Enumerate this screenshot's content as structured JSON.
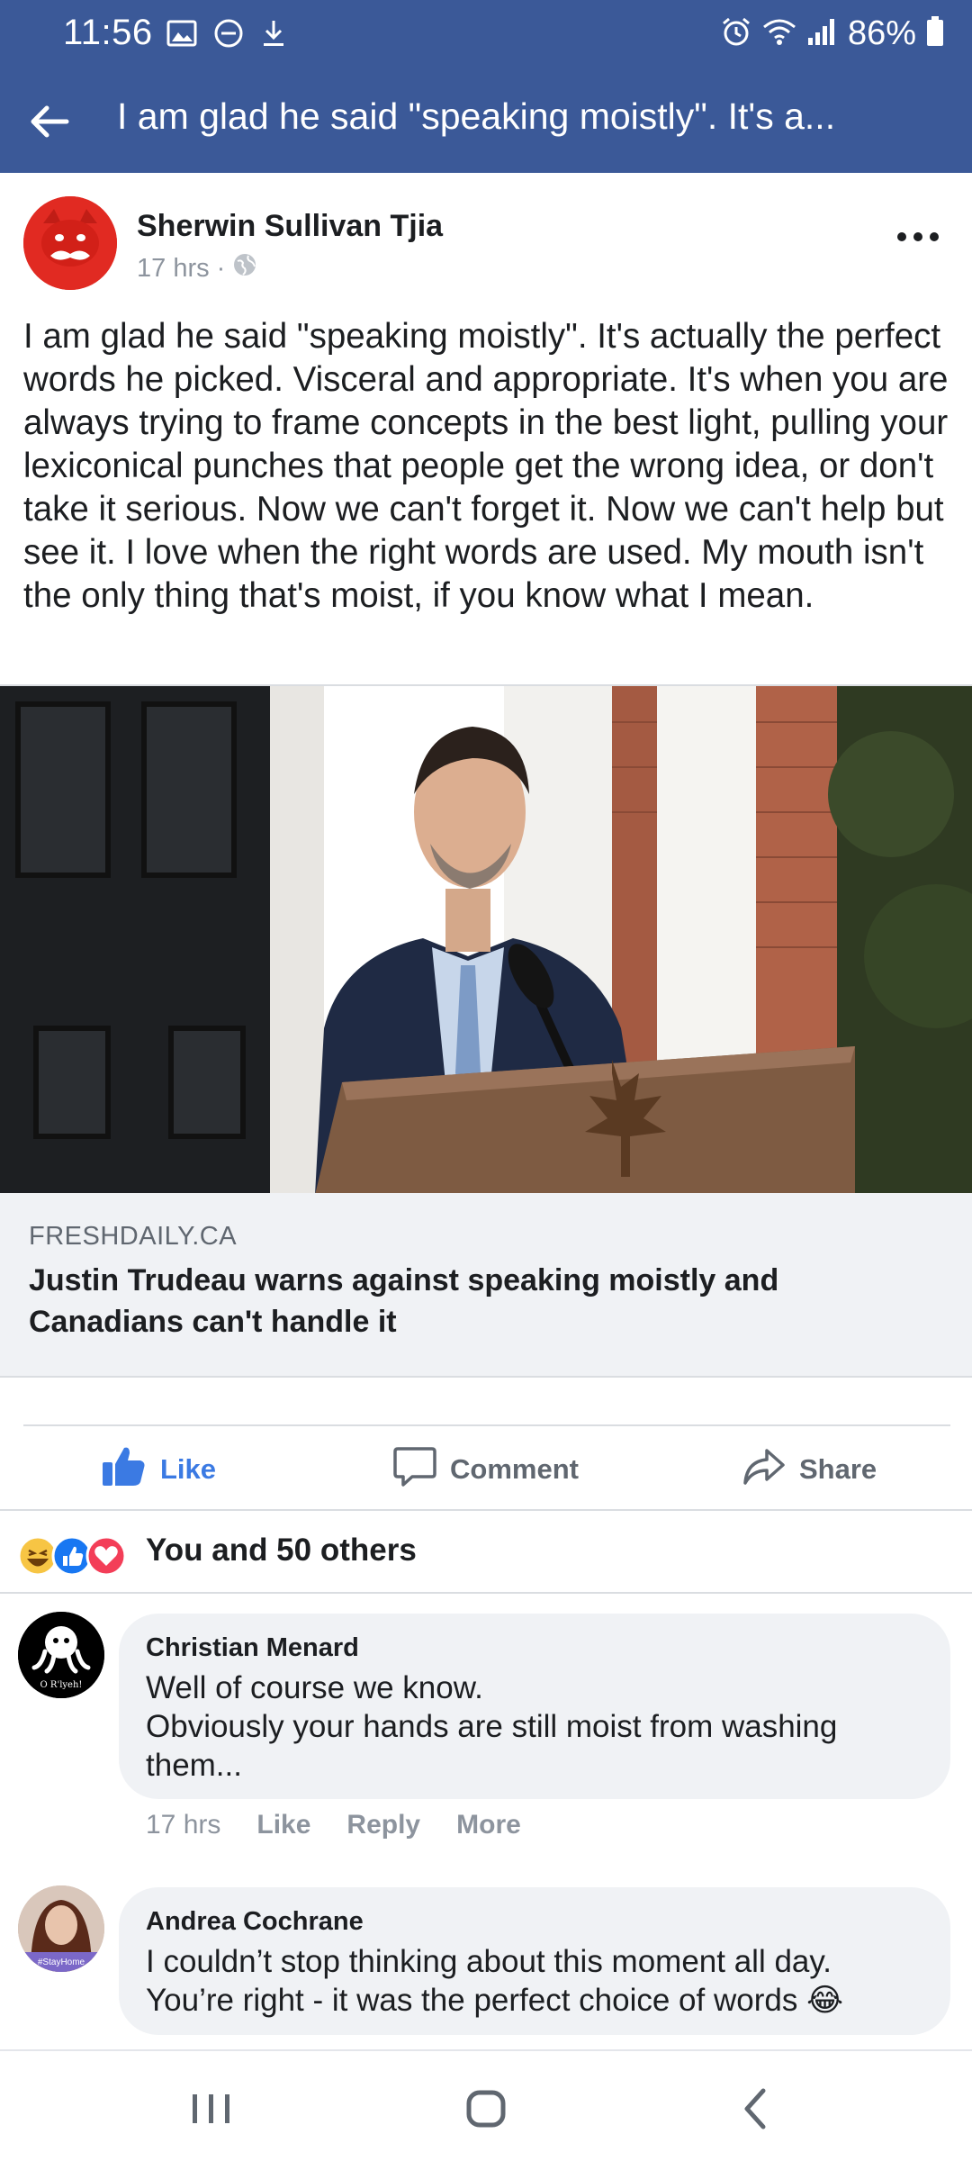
{
  "status_bar": {
    "time": "11:56",
    "battery": "86%",
    "icons": [
      "gallery-icon",
      "dnd-icon",
      "download-icon",
      "alarm-icon",
      "wifi-icon",
      "signal-icon",
      "battery-icon"
    ]
  },
  "header": {
    "back_icon": "arrow-left-icon",
    "title": "I am glad he said \"speaking moistly\". It's a..."
  },
  "post": {
    "author": "Sherwin Sullivan Tjia",
    "time": "17 hrs",
    "separator": "·",
    "privacy_icon": "globe-icon",
    "more_icon": "more-dots-icon",
    "text": "I am glad he said \"speaking moistly\". It's actually the perfect words he picked. Visceral and appropriate. It's when you are always trying to frame concepts in the best light, pulling your lexiconical punches that people get the wrong idea, or don't take it serious. Now we can't forget it. Now we can't help but see it. I love when the right words are used. My mouth isn't the only thing that's moist, if you know what I mean.",
    "link": {
      "domain": "FRESHDAILY.CA",
      "title": "Justin Trudeau warns against speaking moistly and Canadians can't handle it"
    }
  },
  "actions": {
    "like": "Like",
    "comment": "Comment",
    "share": "Share"
  },
  "reactions": {
    "summary": "You and 50 others",
    "icons": [
      "haha-icon",
      "like-icon",
      "love-icon"
    ]
  },
  "comments": [
    {
      "author": "Christian Menard",
      "text_line1": "Well of course we know.",
      "text_line2": "Obviously your hands are still moist from washing them...",
      "time": "17 hrs",
      "like": "Like",
      "reply": "Reply",
      "more": "More",
      "avatar_caption": "O R'lyeh!"
    },
    {
      "author": "Andrea Cochrane",
      "text_line1": "I couldn’t stop thinking about this moment all day.",
      "text_line2": "You’re right - it was the perfect choice of words",
      "emoji": "😂",
      "avatar_caption": "#StayHome"
    }
  ],
  "colors": {
    "brand": "#3b5998",
    "like_blue": "#3b7ae3",
    "bubble": "#f0f2f5",
    "muted": "#8d949e"
  }
}
